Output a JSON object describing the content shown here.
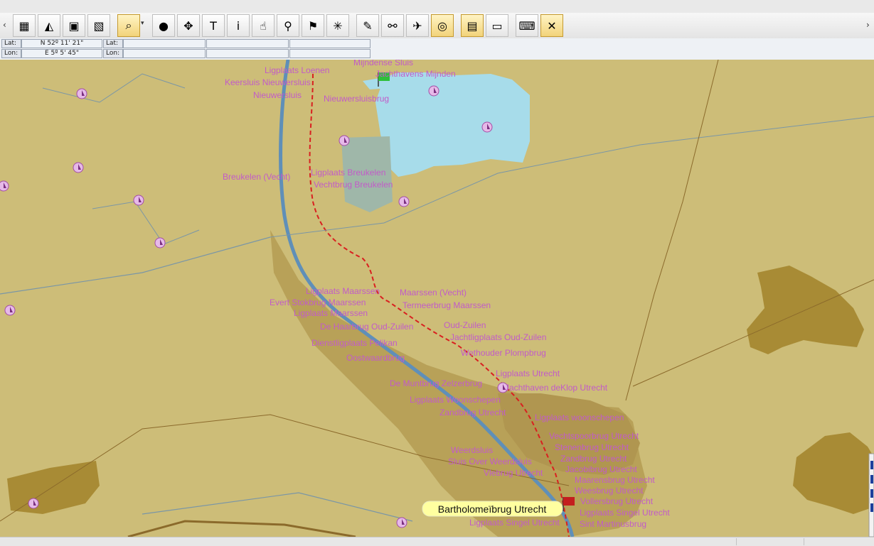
{
  "colors": {
    "land": "#cdbd78",
    "water": "#a7dcea",
    "built": "#b8a158",
    "darkarea": "#a88b35",
    "road": "#7a96a6",
    "canal": "#5f8fb8",
    "route": "#d92020",
    "label": "#c25bc8",
    "highlight_label_bg": "#ffffa0"
  },
  "toolbar": {
    "buttons": [
      {
        "icon": "map-open-icon",
        "glyph": "▦"
      },
      {
        "icon": "terrain-icon",
        "glyph": "◭"
      },
      {
        "icon": "save-icon",
        "glyph": "▣"
      },
      {
        "icon": "picture-icon",
        "glyph": "▧"
      },
      {
        "icon": "zoom-icon",
        "glyph": "⌕"
      },
      {
        "icon": "globe-icon",
        "glyph": "●"
      },
      {
        "icon": "pan-move-icon",
        "glyph": "✥"
      },
      {
        "icon": "text-tool-icon",
        "glyph": "T"
      },
      {
        "icon": "info-icon",
        "glyph": "i"
      },
      {
        "icon": "pointer-hand-icon",
        "glyph": "☝"
      },
      {
        "icon": "pushpin-icon",
        "glyph": "⚲"
      },
      {
        "icon": "flag-icon",
        "glyph": "⚑"
      },
      {
        "icon": "sparkle-icon",
        "glyph": "✳"
      },
      {
        "icon": "route-tool-icon",
        "glyph": "✎"
      },
      {
        "icon": "measure-icon",
        "glyph": "⚯"
      },
      {
        "icon": "satellite-icon",
        "glyph": "✈"
      },
      {
        "icon": "gps-target-icon",
        "glyph": "◎"
      },
      {
        "icon": "chart-layer-icon",
        "glyph": "▤"
      },
      {
        "icon": "monitor-icon",
        "glyph": "▭"
      },
      {
        "icon": "keyboard-icon",
        "glyph": "⌨"
      },
      {
        "icon": "fullscreen-icon",
        "glyph": "✕"
      }
    ]
  },
  "coords": {
    "lat_label": "Lat:",
    "lon_label": "Lon:",
    "lat_value": "N 52º 11' 21\"",
    "lon_value": "E 5º 5' 45\"",
    "lat2_label": "Lat:",
    "lon2_label": "Lon:"
  },
  "map": {
    "labels": [
      "Mijndense Sluis",
      "Jachthavens Mijnden",
      "Keersluis Nieuwersluis",
      "Nieuwersluis",
      "Nieuwersluisbrug",
      "Ligplaats Loenen",
      "Breukelen (Vecht)",
      "Ligplaats Breukelen",
      "Vechtbrug Breukelen",
      "Ligplaats Maarssen",
      "Maarssen (Vecht)",
      "Evert Stokbrug Maarssen",
      "Termeerbrug Maarssen",
      "Ligplaats Maarssen",
      "De Haarbrug Oud-Zuilen",
      "Oud-Zuilen",
      "Jachtligplaats Oud-Zuilen",
      "Dienstligplaats Pelikan",
      "Wethouder Plompbrug",
      "Oostwaardbrug",
      "Ligplaats Utrecht",
      "De Muntbrug Zelzerbrug",
      "Jachthaven deKlop Utrecht",
      "Ligplaats Woonschepen",
      "Ligplaats woonschepen",
      "Zandbrug Utrecht",
      "Vechtspoorbrug Utrecht",
      "Stenenbrug Utrecht",
      "Zandbrug Utrecht",
      "Weerdsluis",
      "Jacobibrug Utrecht",
      "Sluis Over Weerdsluis",
      "Vlebrug Utrecht",
      "Maarensbrug Utrecht",
      "Weesbrug Utrecht",
      "Bartholomeïbrug Utrecht",
      "Vollersbrug Utrecht",
      "Ligplaats Singel Utrecht",
      "Ligplaats Singel Utrecht",
      "Sint Martinusbrug"
    ],
    "highlight_label": "Bartholomeïbrug Utrecht",
    "icons": {
      "marina": "marina-sailboat-icon",
      "start": "green-flag-icon",
      "end": "red-flag-icon"
    }
  }
}
